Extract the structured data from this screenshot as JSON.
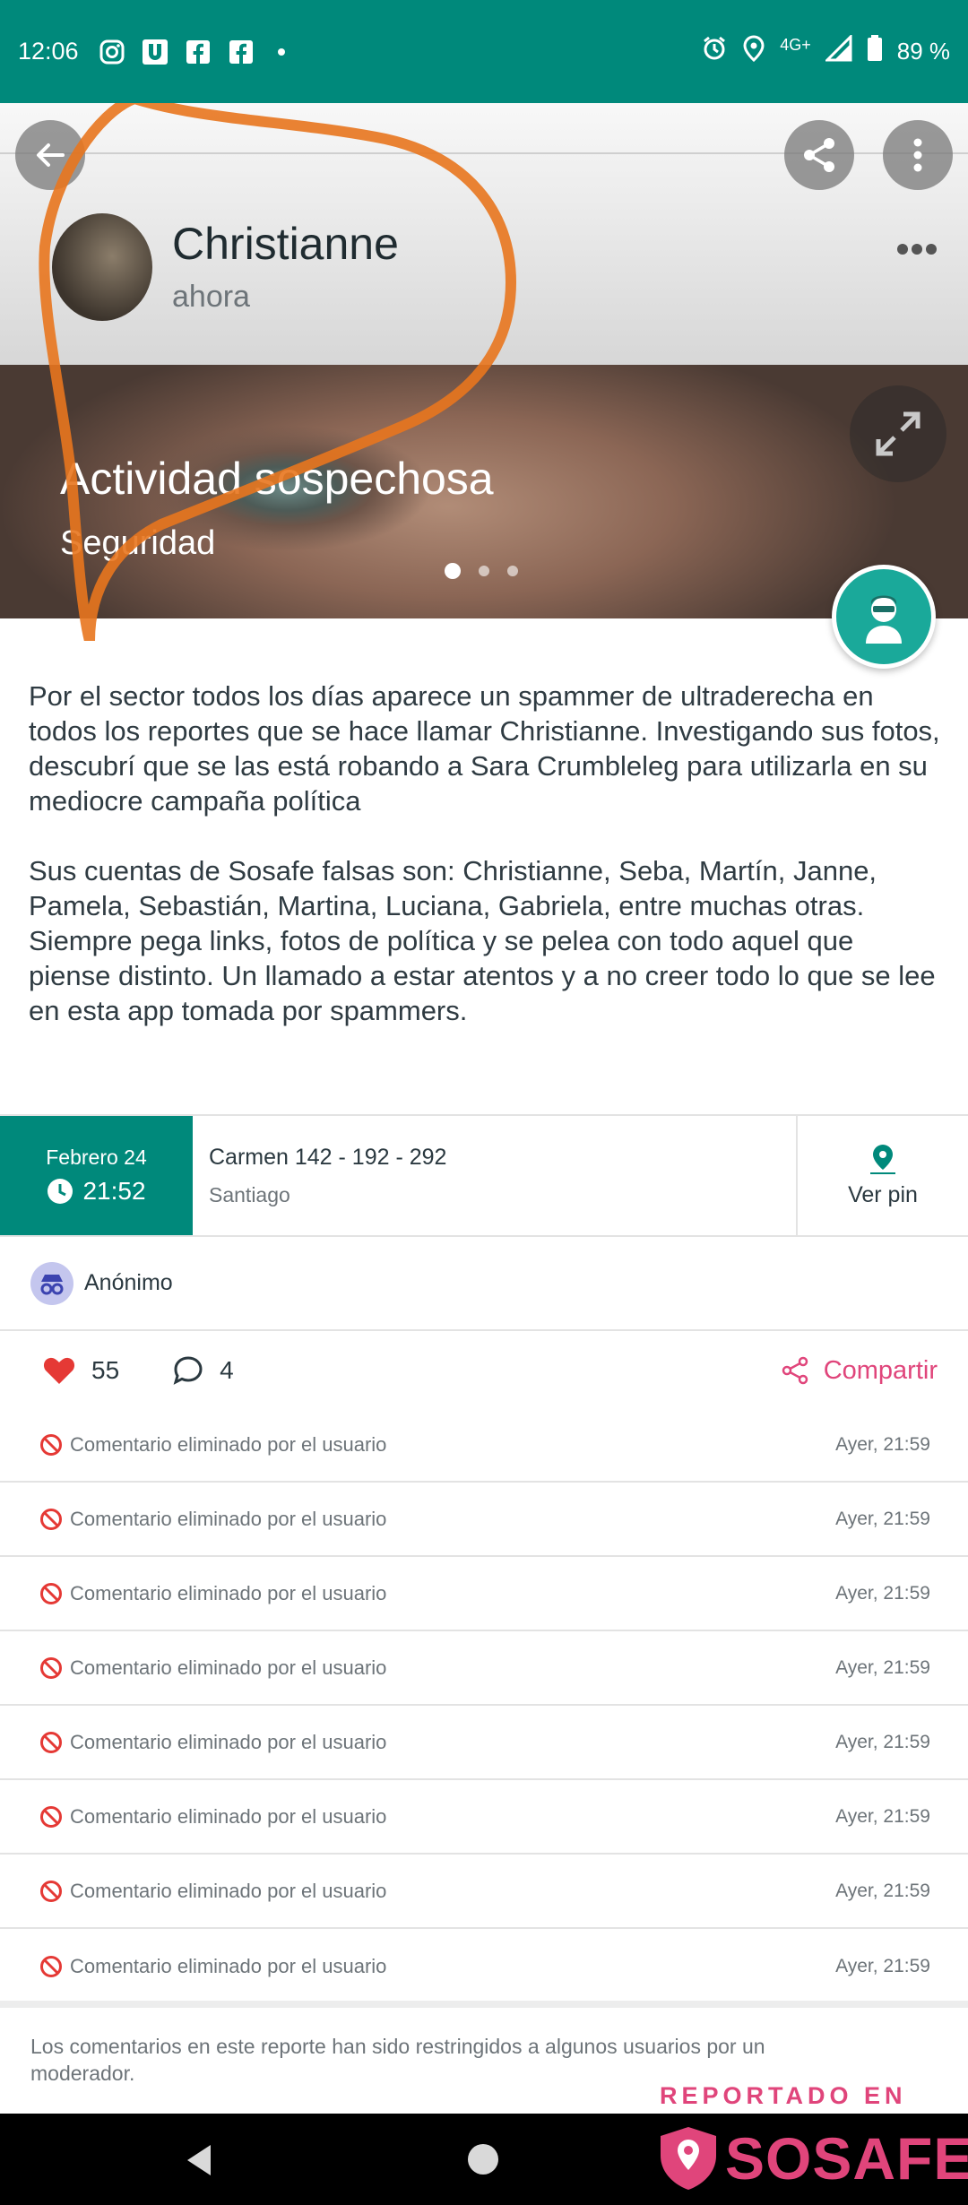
{
  "status_bar": {
    "time": "12:06",
    "network": "4G+",
    "battery": "89 %"
  },
  "post": {
    "author": "Christianne",
    "time_ago": "ahora",
    "title": "Actividad sospechosa",
    "category": "Seguridad",
    "image_pages": 3,
    "image_active_page": 1,
    "description": [
      "Por el sector todos los días aparece un spammer de ultraderecha en todos los reportes que se hace llamar Christianne. Investigando sus fotos, descubrí que se las está robando a Sara Crumbleleg para utilizarla en su mediocre campaña política",
      "Sus cuentas de Sosafe falsas son: Christianne, Seba, Martín, Janne, Pamela, Sebastián, Martina, Luciana, Gabriela, entre muchas otras. Siempre pega links, fotos de política y se pelea con todo aquel que piense distinto. Un llamado a estar atentos y a no creer todo lo que se lee en esta app tomada por spammers."
    ]
  },
  "info": {
    "date": "Febrero 24",
    "time": "21:52",
    "address": "Carmen  142 - 192 - 292",
    "city": "Santiago",
    "pin_label": "Ver pin"
  },
  "reporter": {
    "label": "Anónimo"
  },
  "actions": {
    "likes": "55",
    "comments": "4",
    "share_label": "Compartir"
  },
  "comments": [
    {
      "text": "Comentario eliminado por el usuario",
      "time": "Ayer, 21:59"
    },
    {
      "text": "Comentario eliminado por el usuario",
      "time": "Ayer, 21:59"
    },
    {
      "text": "Comentario eliminado por el usuario",
      "time": "Ayer, 21:59"
    },
    {
      "text": "Comentario eliminado por el usuario",
      "time": "Ayer, 21:59"
    },
    {
      "text": "Comentario eliminado por el usuario",
      "time": "Ayer, 21:59"
    },
    {
      "text": "Comentario eliminado por el usuario",
      "time": "Ayer, 21:59"
    },
    {
      "text": "Comentario eliminado por el usuario",
      "time": "Ayer, 21:59"
    },
    {
      "text": "Comentario eliminado por el usuario",
      "time": "Ayer, 21:59"
    }
  ],
  "footer_note": "Los comentarios en este reporte han sido restringidos a algunos usuarios por un moderador.",
  "watermark": {
    "reported_label": "REPORTADO EN",
    "brand": "SOSAFE"
  },
  "colors": {
    "primary": "#00897b",
    "accent": "#e0457b",
    "annotation": "#e8761e"
  }
}
